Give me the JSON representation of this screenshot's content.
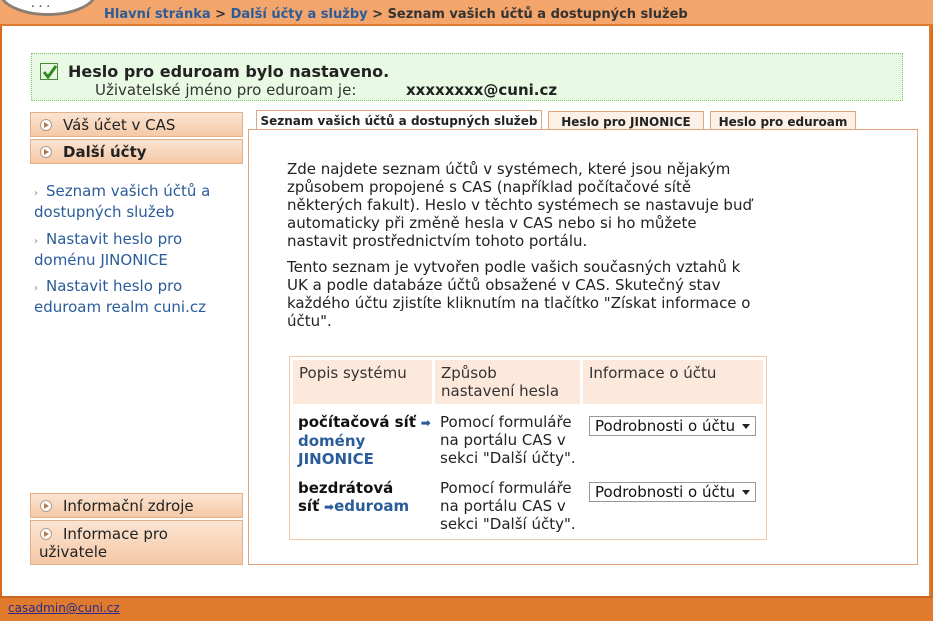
{
  "breadcrumb": {
    "home": "Hlavní stránka",
    "sep1": " > ",
    "other": "Další účty a služby",
    "sep2": " > ",
    "current": "Seznam vašich účtů a dostupných služeb"
  },
  "alert": {
    "title": "Heslo pro eduroam bylo nastaveno.",
    "username_label": "Uživatelské jméno pro eduroam je:",
    "username_value": "xxxxxxxx@cuni.cz"
  },
  "sidebar": {
    "cas_account": "Váš účet v CAS",
    "other_accounts": "Další účty",
    "links": [
      "Seznam vašich účtů a dostupných služeb",
      "Nastavit heslo pro doménu JINONICE",
      "Nastavit heslo pro eduroam realm cuni.cz"
    ],
    "info_sources": "Informační zdroje",
    "user_info": "Informace pro uživatele"
  },
  "tabs": [
    "Seznam vašich účtů a dostupných služeb",
    "Heslo pro JINONICE",
    "Heslo pro eduroam"
  ],
  "intro": {
    "p1": "Zde najdete seznam účtů v systémech, které jsou nějakým způsobem propojené s CAS (například počítačové sítě některých fakult). Heslo v těchto systémech se nastavuje buď automaticky při změně hesla v CAS nebo si ho můžete nastavit prostřednictvím tohoto portálu.",
    "p2": "Tento seznam je vytvořen podle vašich současných vztahů k UK a podle databáze účtů obsažené v CAS. Skutečný stav každého účtu zjistíte kliknutím na tlačítko \"Získat informace o účtu\"."
  },
  "table": {
    "headers": [
      "Popis systému",
      "Způsob nastavení hesla",
      "Informace o účtu"
    ],
    "rows": [
      {
        "system_prefix": "počítačová síť",
        "system_link": "domény JINONICE",
        "method": "Pomocí formuláře na portálu CAS v sekci \"Další účty\".",
        "select": "Podrobnosti o účtu"
      },
      {
        "system_prefix": "bezdrátová síť",
        "system_link": "eduroam",
        "method": "Pomocí formuláře na portálu CAS v sekci \"Další účty\".",
        "select": "Podrobnosti o účtu"
      }
    ]
  },
  "footer": {
    "email": "casadmin@cuni.cz"
  }
}
